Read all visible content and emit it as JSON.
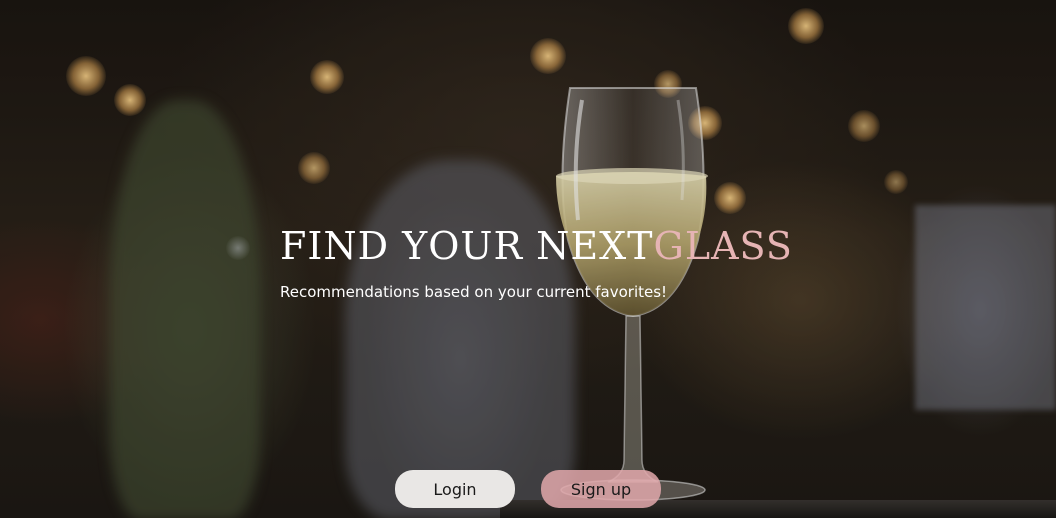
{
  "hero": {
    "headline_main": "FIND YOUR NEXT",
    "headline_accent": "GLASS",
    "subtitle": "Recommendations based on your current favorites!",
    "accent_color": "#e6b4b4"
  },
  "actions": {
    "login_label": "Login",
    "signup_label": "Sign up",
    "signup_color": "#e2a8ac"
  },
  "background": {
    "description_icon": "wine-glass-icon"
  }
}
